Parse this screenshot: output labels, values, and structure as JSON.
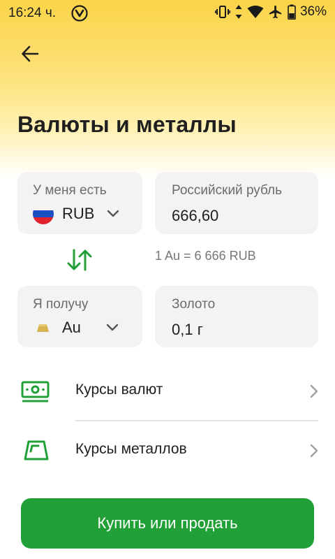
{
  "status_bar": {
    "time": "16:24 ч.",
    "battery": "36%",
    "icons": [
      "app-notification-icon",
      "vibrate-icon",
      "data-arrows-icon",
      "wifi-icon",
      "airplane-icon",
      "battery-icon"
    ]
  },
  "header": {
    "back_icon": "arrow-left-icon",
    "title": "Валюты и металлы"
  },
  "exchange": {
    "have": {
      "label": "У меня есть",
      "currency_code": "RUB",
      "flag": "russia-flag-icon",
      "amount_label": "Российский рубль",
      "amount": "666,60"
    },
    "swap_icon": "swap-arrows-icon",
    "rate": "1 Au = 6 666 RUB",
    "get": {
      "label": "Я получу",
      "currency_code": "Au",
      "icon": "gold-bar-icon",
      "amount_label": "Золото",
      "amount": "0,1 г"
    }
  },
  "links": [
    {
      "label": "Курсы валют",
      "icon": "banknote-icon"
    },
    {
      "label": "Курсы металлов",
      "icon": "metal-ingot-icon"
    }
  ],
  "primary_button": {
    "label": "Купить или продать"
  },
  "colors": {
    "accent_green": "#21a038",
    "header_yellow": "#fbd448",
    "card_bg": "#f3f3f3",
    "gold": "#d9b352"
  }
}
